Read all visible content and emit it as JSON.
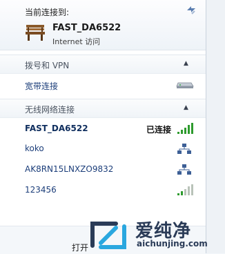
{
  "header": {
    "title": "当前连接到:",
    "network_name": "FAST_DA6522",
    "network_status": "Internet 访问"
  },
  "dialup_section": {
    "label": "拨号和 VPN",
    "items": [
      {
        "label": "宽带连接",
        "icon": "modem-icon"
      }
    ]
  },
  "wireless_section": {
    "label": "无线网络连接",
    "networks": [
      {
        "name": "FAST_DA6522",
        "status": "已连接",
        "icon": "wifi-signal-icon",
        "signal_bars": 5
      },
      {
        "name": "koko",
        "icon": "shared-network-icon"
      },
      {
        "name": "AK8RN15LNXZO9832",
        "icon": "shared-network-icon"
      },
      {
        "name": "123456",
        "icon": "wifi-signal-icon",
        "signal_bars": 2
      }
    ]
  },
  "footer": {
    "open_link_text": "打开"
  },
  "watermark": {
    "chinese": "爱纯净",
    "url": "aichunjing.com"
  },
  "colors": {
    "link_blue": "#1c3e7a",
    "signal_green": "#2e9b2e",
    "section_text": "#4a5360"
  }
}
